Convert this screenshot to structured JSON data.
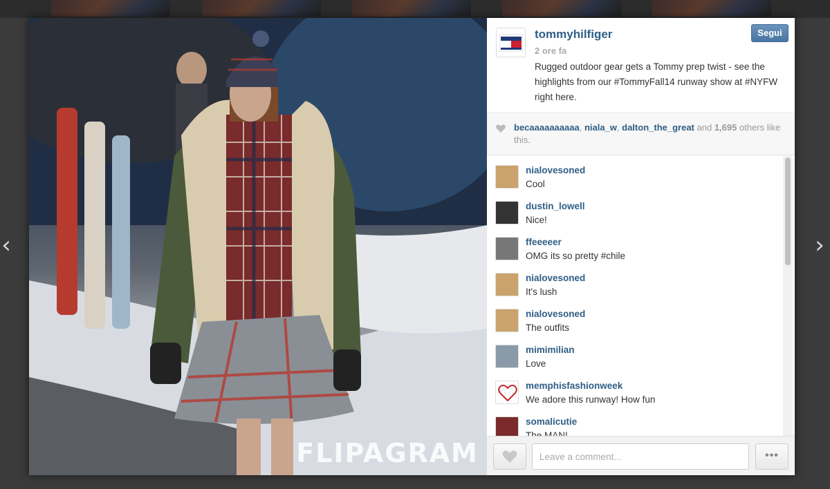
{
  "post": {
    "username": "tommyhilfiger",
    "time": "2 ore fa",
    "caption": "Rugged outdoor gear gets a Tommy prep twist - see the highlights from our #TommyFall14 runway show at #NYFW right here.",
    "follow_label": "Segui",
    "watermark": "FLIPAGRAM"
  },
  "likes": {
    "users": [
      "becaaaaaaaaaa",
      "niala_w",
      "dalton_the_great"
    ],
    "sep1": ", ",
    "sep2": ", ",
    "and_text": " and ",
    "count": "1,695",
    "suffix": " others like this."
  },
  "comments": [
    {
      "user": "nialovesoned",
      "text": "Cool",
      "avatar_color": "#c9a36b"
    },
    {
      "user": "dustin_lowell",
      "text": "Nice!",
      "avatar_color": "#333333"
    },
    {
      "user": "ffeeeeer",
      "text": "OMG its so pretty #chile",
      "avatar_color": "#777777"
    },
    {
      "user": "nialovesoned",
      "text": "It's lush",
      "avatar_color": "#c9a36b"
    },
    {
      "user": "nialovesoned",
      "text": "The outfits",
      "avatar_color": "#c9a36b"
    },
    {
      "user": "mimimilian",
      "text": "Love",
      "avatar_color": "#8a9aa8"
    },
    {
      "user": "memphisfashionweek",
      "text": "We adore this runway! How fun",
      "avatar_color": "#ffffff"
    },
    {
      "user": "somalicutie",
      "text": "The MAN!",
      "avatar_color": "#7a2a2a"
    }
  ],
  "footer": {
    "comment_placeholder": "Leave a comment...",
    "more_label": "•••"
  },
  "nav": {
    "prev": "‹",
    "next": "›"
  },
  "colors": {
    "link": "#2e5e86",
    "follow_button": "#4a76a4",
    "backdrop": "#3b3b3b"
  }
}
